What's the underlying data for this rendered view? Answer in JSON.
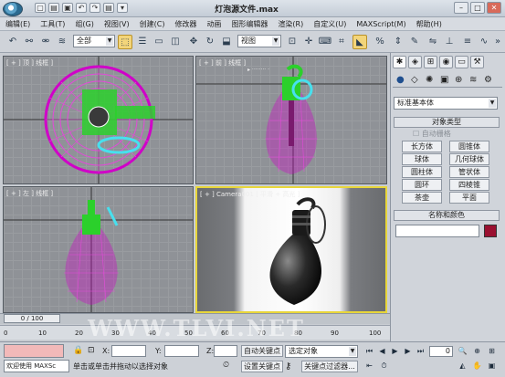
{
  "window": {
    "title": "灯泡源文件.max",
    "controls": [
      "–",
      "□",
      "✕"
    ]
  },
  "quick_access": [
    "↶",
    "↷",
    "▤",
    "▾"
  ],
  "menu": [
    "编辑(E)",
    "工具(T)",
    "组(G)",
    "视图(V)",
    "创建(C)",
    "修改器",
    "动画",
    "图形编辑器",
    "渲染(R)",
    "自定义(U)",
    "MAXScript(M)",
    "帮助(H)"
  ],
  "toolbar": {
    "selection_filter": "全部",
    "ref_coord": "视图"
  },
  "viewports": {
    "top": "[ + ] 顶 ] 线框 ]",
    "front": "[ + ] 前 ] 线框 ]",
    "left": "[ + ] 左 ] 线框 ]",
    "camera": "[ + ] Camera001 ] 平滑 + 高光 ]"
  },
  "command_panel": {
    "category": "标准基本体",
    "object_type_title": "对象类型",
    "auto_grid": "自动栅格",
    "buttons": [
      "长方体",
      "圆锥体",
      "球体",
      "几何球体",
      "圆柱体",
      "管状体",
      "圆环",
      "四棱锥",
      "茶壶",
      "平面"
    ],
    "name_color_title": "名称和颜色",
    "color": "#9a1030"
  },
  "time": {
    "slider": "0 / 100",
    "ticks": [
      "0",
      "10",
      "20",
      "30",
      "40",
      "50",
      "60",
      "70",
      "80",
      "90",
      "100"
    ]
  },
  "status": {
    "listener": "欢迎使用 MAXSc",
    "prompt": "单击或单击并拖动以选择对象",
    "x_label": "X:",
    "y_label": "Y:",
    "z_label": "Z:",
    "auto_key": "自动关键点",
    "set_key": "设置关键点",
    "selected_set": "选定对象",
    "key_filters": "关键点过滤器...",
    "frame": "0"
  },
  "watermark": "WWW.TLVI.NET"
}
